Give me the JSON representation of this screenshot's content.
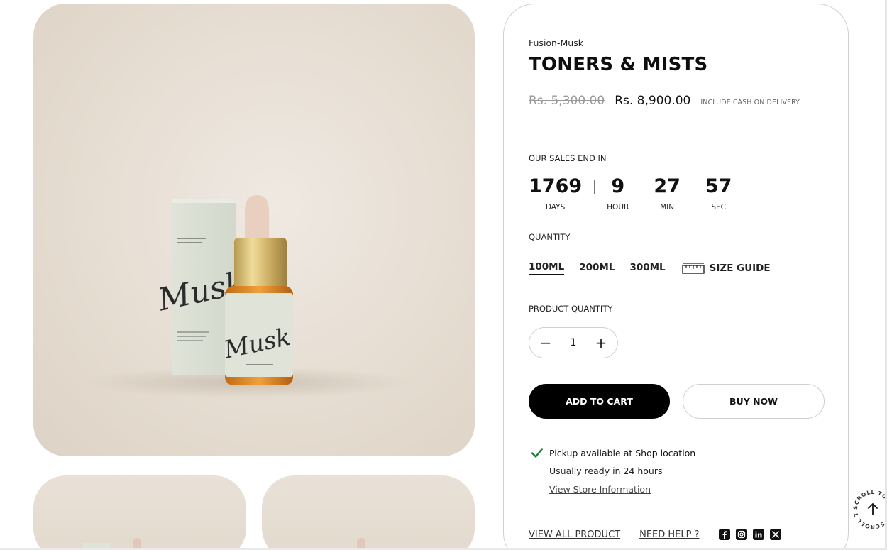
{
  "product": {
    "vendor": "Fusion-Musk",
    "title": "TONERS & MISTS",
    "price_compare": "Rs. 5,300.00",
    "price": "Rs. 8,900.00",
    "price_note": "INCLUDE CASH ON DELIVERY",
    "image_alt": "Musk dropper bottle with box"
  },
  "sale": {
    "label": "OUR SALES END IN",
    "countdown": [
      {
        "value": "1769",
        "unit": "DAYS"
      },
      {
        "value": "9",
        "unit": "HOUR"
      },
      {
        "value": "27",
        "unit": "MIN"
      },
      {
        "value": "57",
        "unit": "SEC"
      }
    ]
  },
  "quantity": {
    "label": "QUANTITY",
    "options": [
      "100ML",
      "200ML",
      "300ML"
    ],
    "selected": "100ML",
    "size_guide": "SIZE GUIDE"
  },
  "product_quantity": {
    "label": "PRODUCT QUANTITY",
    "minus": "−",
    "value": "1",
    "plus": "+"
  },
  "actions": {
    "add_to_cart": "ADD TO CART",
    "buy_now": "BUY NOW"
  },
  "pickup": {
    "availability": "Pickup available at Shop location",
    "ready": "Usually ready in 24 hours",
    "store_link": "View Store Information"
  },
  "footer": {
    "view_all": "VIEW ALL PRODUCT",
    "need_help": "NEED HELP ?",
    "social": [
      "facebook-icon",
      "instagram-icon",
      "linkedin-icon",
      "x-icon"
    ]
  },
  "scroll_top": {
    "text": "SCROLL TO TOP - SCROLL TO TOP -"
  },
  "colors": {
    "accent": "#000000",
    "check": "#1f7a3a",
    "border": "#cfcfcf",
    "photo_bg": "#e8e0d6"
  }
}
